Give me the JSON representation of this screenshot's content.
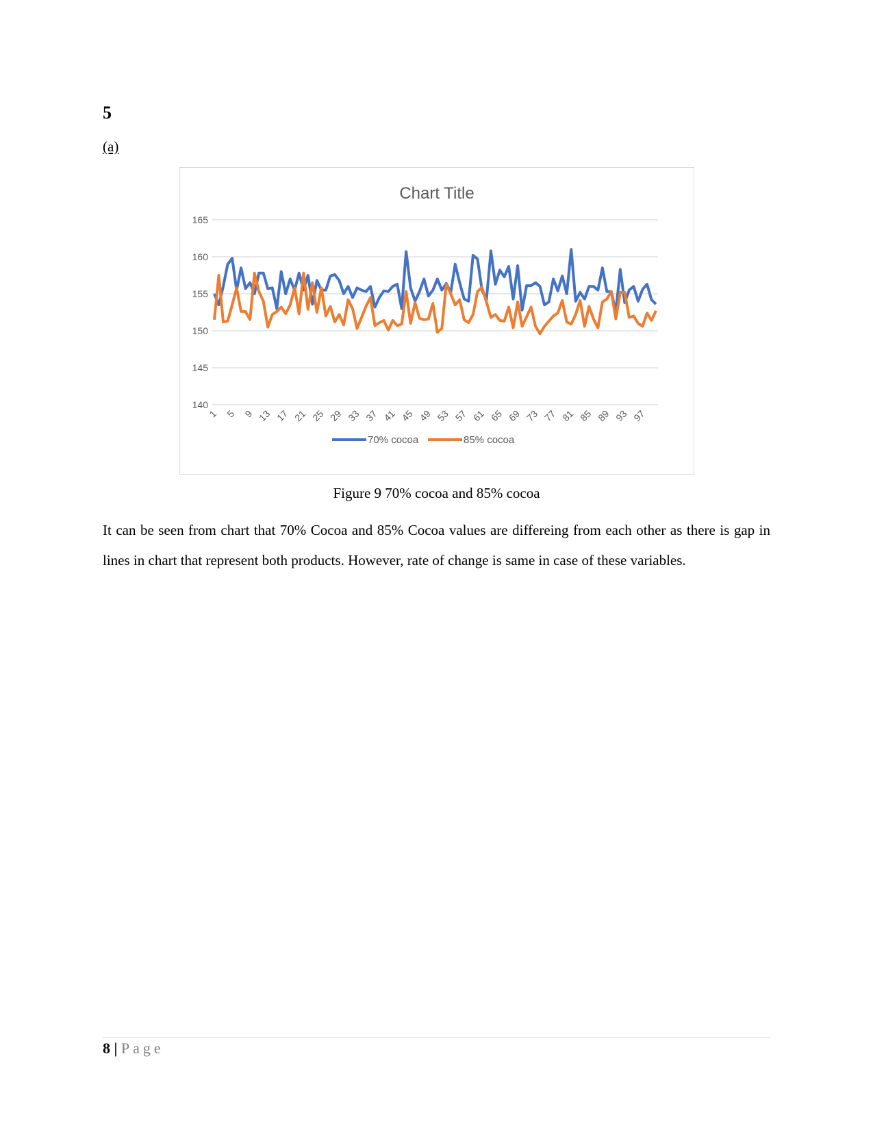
{
  "heading": "5",
  "subheading": "(a)",
  "caption": "Figure 9 70% cocoa and 85% cocoa",
  "paragraph": "It can be seen from chart that 70% Cocoa and 85% Cocoa values are differeing from each other as there is gap in lines in chart that represent both products. However, rate of change is same in case of these variables.",
  "footer": {
    "page_number": "8",
    "separator": "|",
    "label": "Page"
  },
  "chart_data": {
    "type": "line",
    "title": "Chart Title",
    "ylim": [
      140,
      165
    ],
    "yticks": [
      140,
      145,
      150,
      155,
      160,
      165
    ],
    "xtick_labels": [
      "1",
      "5",
      "9",
      "13",
      "17",
      "21",
      "25",
      "29",
      "33",
      "37",
      "41",
      "45",
      "49",
      "53",
      "57",
      "61",
      "65",
      "69",
      "73",
      "77",
      "81",
      "85",
      "89",
      "93",
      "97"
    ],
    "grid": true,
    "legend": "bottom",
    "series": [
      {
        "name": "70% cocoa",
        "color": "#4472c4",
        "values": [
          155,
          153.5,
          156,
          159,
          159.8,
          155.5,
          158.5,
          155.7,
          156.5,
          155,
          157.8,
          157.8,
          155.7,
          155.8,
          153,
          158,
          155,
          157,
          155.5,
          157.8,
          155.5,
          157.5,
          153.6,
          156.8,
          155.5,
          155.5,
          157.4,
          157.6,
          156.8,
          155,
          156,
          154.5,
          155.8,
          155.5,
          155.3,
          156,
          153.2,
          154.5,
          155.4,
          155.3,
          156,
          156.3,
          153,
          160.7,
          155.8,
          154,
          155.3,
          157,
          154.7,
          155.5,
          157,
          155.5,
          156.4,
          155.2,
          159,
          156.5,
          154.3,
          154,
          160.2,
          159.7,
          155.5,
          154.2,
          160.8,
          156.3,
          158.2,
          157.3,
          158.7,
          154.3,
          158.8,
          152.8,
          156.1,
          156.1,
          156.5,
          156,
          153.5,
          153.9,
          157,
          155.4,
          157.4,
          155,
          161,
          154,
          155.2,
          154.3,
          156,
          156,
          155.5,
          158.5,
          155.3,
          155.3,
          152.5,
          158.3,
          153.8,
          155.5,
          156,
          154,
          155.6,
          156.3,
          154.2,
          153.6
        ]
      },
      {
        "name": "85% cocoa",
        "color": "#ed7d31",
        "values": [
          151.5,
          157.5,
          151.2,
          151.3,
          153.5,
          155.8,
          152.6,
          152.6,
          151.5,
          157.8,
          155.3,
          154,
          150.5,
          152.2,
          152.6,
          153.2,
          152.3,
          153.5,
          155.8,
          152.3,
          157.8,
          152.9,
          156.5,
          152.5,
          155.8,
          152,
          153.3,
          151.2,
          152.2,
          150.8,
          154.2,
          153,
          150.3,
          151.8,
          153.3,
          154.5,
          150.7,
          151.1,
          151.4,
          150.1,
          151.4,
          150.7,
          150.9,
          155.3,
          151,
          153.8,
          151.7,
          151.5,
          151.6,
          153.7,
          149.8,
          150.3,
          156.3,
          155,
          153.5,
          154.2,
          151.5,
          151.1,
          152.2,
          155.3,
          155.9,
          153.9,
          151.8,
          152.2,
          151.4,
          151.3,
          153.2,
          150.4,
          153.9,
          150.6,
          151.9,
          153.2,
          150.6,
          149.6,
          150.6,
          151.3,
          152,
          152.4,
          154.1,
          151.2,
          150.9,
          152.2,
          154.1,
          150.6,
          153.3,
          151.6,
          150.4,
          153.9,
          154.3,
          155.3,
          151.6,
          155.2,
          155.2,
          151.8,
          152,
          151,
          150.6,
          152.4,
          151.4,
          152.7
        ]
      }
    ]
  }
}
